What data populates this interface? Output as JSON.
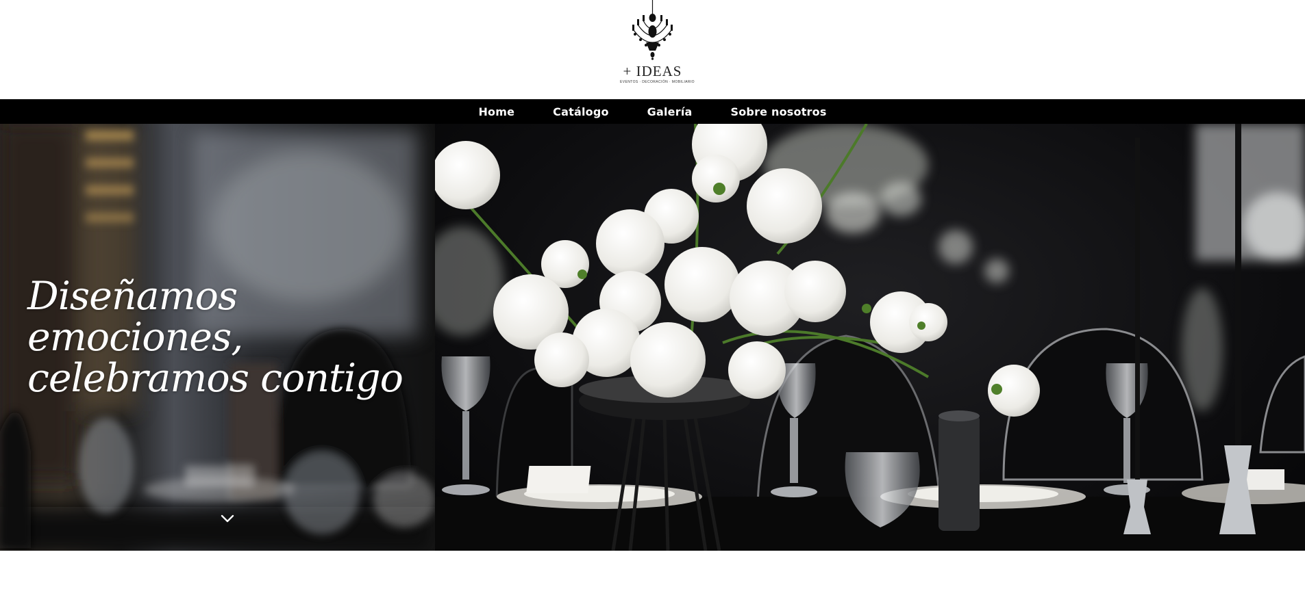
{
  "brand": {
    "name": "+ IDEAS",
    "tagline": "EVENTOS · DECORACIÓN · MOBILIARIO",
    "logo_icon": "chandelier-icon"
  },
  "nav": {
    "items": [
      {
        "label": "Home"
      },
      {
        "label": "Catálogo"
      },
      {
        "label": "Galería"
      },
      {
        "label": "Sobre nosotros"
      }
    ]
  },
  "hero": {
    "headline_lines": [
      "Diseñamos",
      "emociones,",
      "celebramos contigo"
    ],
    "scroll_icon": "chevron-down-icon",
    "image": "white-flower-centerpiece-table-setting"
  },
  "colors": {
    "nav_bg": "#000000",
    "nav_text": "#ffffff",
    "headline": "#ffffff"
  }
}
